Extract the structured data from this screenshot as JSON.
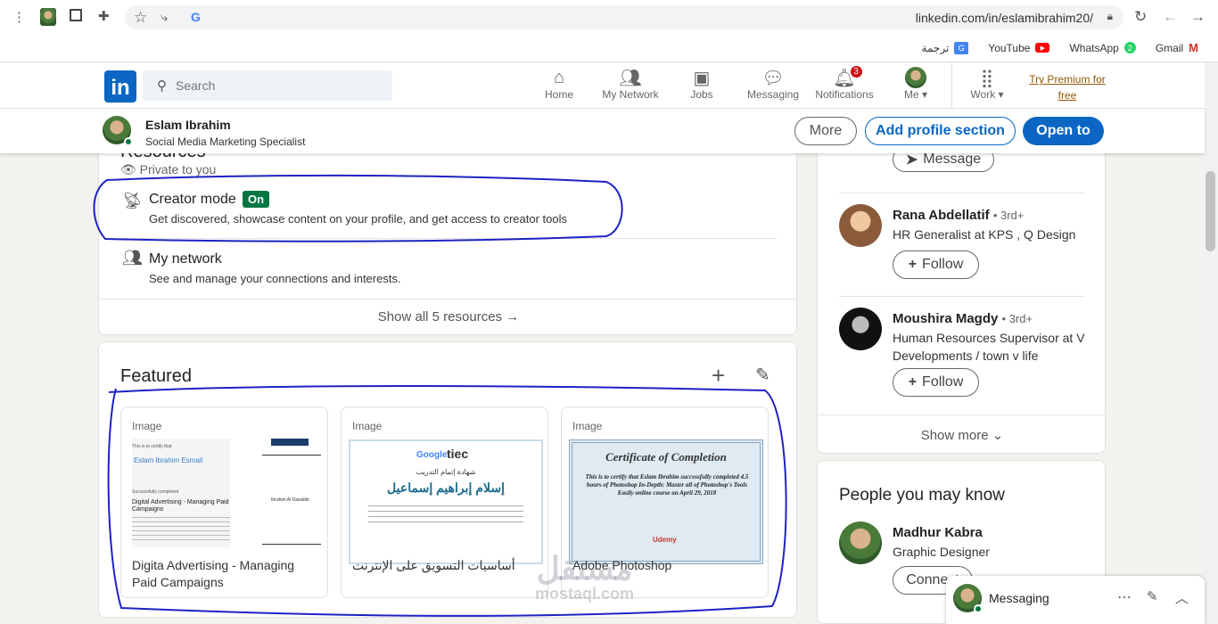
{
  "browser": {
    "url": "linkedin.com/in/eslamibrahim20/",
    "bookmarks": [
      {
        "label": "ترجمة",
        "icon": "google-translate-icon"
      },
      {
        "label": "YouTube",
        "icon": "youtube-icon"
      },
      {
        "label": "WhatsApp",
        "icon": "whatsapp-icon",
        "count": "2"
      },
      {
        "label": "Gmail",
        "icon": "gmail-icon"
      }
    ]
  },
  "nav": {
    "search_placeholder": "Search",
    "items": [
      {
        "label": "Home",
        "icon": "home-icon"
      },
      {
        "label": "My Network",
        "icon": "network-icon"
      },
      {
        "label": "Jobs",
        "icon": "briefcase-icon"
      },
      {
        "label": "Messaging",
        "icon": "messaging-icon"
      },
      {
        "label": "Notifications",
        "icon": "bell-icon",
        "badge": "3"
      },
      {
        "label": "Me",
        "icon": "avatar"
      },
      {
        "label": "Work",
        "icon": "grid-icon"
      }
    ],
    "premium": "Try Premium for free"
  },
  "profile_bar": {
    "name": "Eslam Ibrahim",
    "headline": "Social Media Marketing Specialist",
    "more": "More",
    "add_section": "Add profile section",
    "open_to": "Open to"
  },
  "resources": {
    "title": "Resources",
    "private": "Private to you",
    "items": [
      {
        "title": "Creator mode",
        "badge": "On",
        "desc": "Get discovered, showcase content on your profile, and get access to creator tools"
      },
      {
        "title": "My network",
        "desc": "See and manage your connections and interests."
      }
    ],
    "show_all": "Show all 5 resources →"
  },
  "featured": {
    "title": "Featured",
    "items": [
      {
        "type": "Image",
        "title": "Digita Advertising - Managing Paid Campaigns"
      },
      {
        "type": "Image",
        "title": "أساسيات التسويق على الإنترنت"
      },
      {
        "type": "Image",
        "title": "Adobe Photoshop"
      }
    ]
  },
  "thumbs": {
    "t1_line1": "This is to certify that",
    "t1_name": "Eslam Ibrahim Esmail",
    "t1_done": "Successfully completed",
    "t1_course": "Digital Advertising - Managing Paid Campaigns",
    "t1_signer": "Ibrahim Al Dawalibi",
    "t2_logo": "tiec",
    "t2_sub": "شهادة إتمام التدريب",
    "t2_name": "إسلام إبراهيم إسماعيل",
    "t3_title": "Certificate of Completion",
    "t3_body": "This is to certify that Eslam Ibrahim successfully completed 4.5 hours of Photoshop In-Depth: Master all of Photoshop's Tools Easily online course on April 29, 2018",
    "t3_brand": "Udemy"
  },
  "sidebar": {
    "message": "Message",
    "people": [
      {
        "name": "Rana Abdellatif",
        "degree": "• 3rd+",
        "title": "HR Generalist at KPS , Q Design",
        "action": "Follow"
      },
      {
        "name": "Moushira Magdy",
        "degree": "• 3rd+",
        "title": "Human Resources Supervisor at V Developments / town v life",
        "action": "Follow"
      }
    ],
    "show_more": "Show more"
  },
  "pymk": {
    "title": "People you may know",
    "people": [
      {
        "name": "Madhur Kabra",
        "title": "Graphic Designer",
        "action": "Connect"
      }
    ]
  },
  "messaging": {
    "label": "Messaging"
  },
  "watermark": {
    "text": "mostaql.com",
    "arabic": "مستقل"
  }
}
